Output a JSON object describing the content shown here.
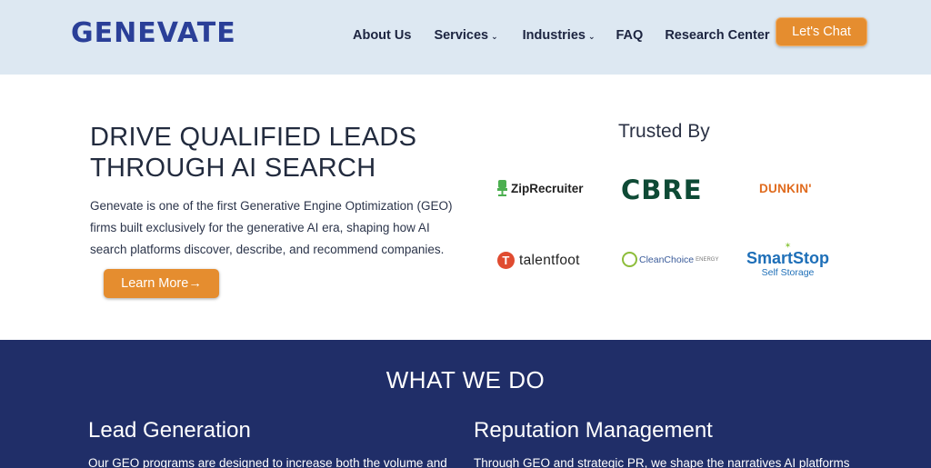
{
  "header": {
    "logo": "GENEVATE",
    "nav": [
      {
        "label": "About Us",
        "has_dropdown": false
      },
      {
        "label": "Services",
        "has_dropdown": true
      },
      {
        "label": "Industries",
        "has_dropdown": true
      },
      {
        "label": "FAQ",
        "has_dropdown": false
      },
      {
        "label": "Research Center",
        "has_dropdown": false
      }
    ],
    "cta": "Let's Chat"
  },
  "hero": {
    "title_line1": "DRIVE QUALIFIED LEADS",
    "title_line2": "THROUGH AI SEARCH",
    "description": "Genevate is one of the first Generative Engine Optimization (GEO) firms built exclusively for the generative AI era, shaping how AI search platforms discover, describe, and recommend companies.",
    "button": "Learn More→"
  },
  "trusted": {
    "heading": "Trusted By",
    "logos": {
      "ziprecruiter": "ZipRecruiter",
      "cbre": "CBRE",
      "dunkin": "DUNKIN'",
      "talentfoot": "talentfoot",
      "cleanchoice": "CleanChoice",
      "cleanchoice_sub": "ENERGY",
      "smartstop": "SmartStop",
      "smartstop_sub": "Self Storage"
    }
  },
  "what_we_do": {
    "title": "WHAT WE DO",
    "columns": [
      {
        "title": "Lead Generation",
        "text": "Our GEO programs are designed to increase both the volume and"
      },
      {
        "title": "Reputation Management",
        "text": "Through GEO and strategic PR, we shape the narratives AI platforms"
      }
    ]
  },
  "colors": {
    "header_bg": "#dde8f2",
    "accent": "#e58d2f",
    "navy": "#202e68"
  }
}
